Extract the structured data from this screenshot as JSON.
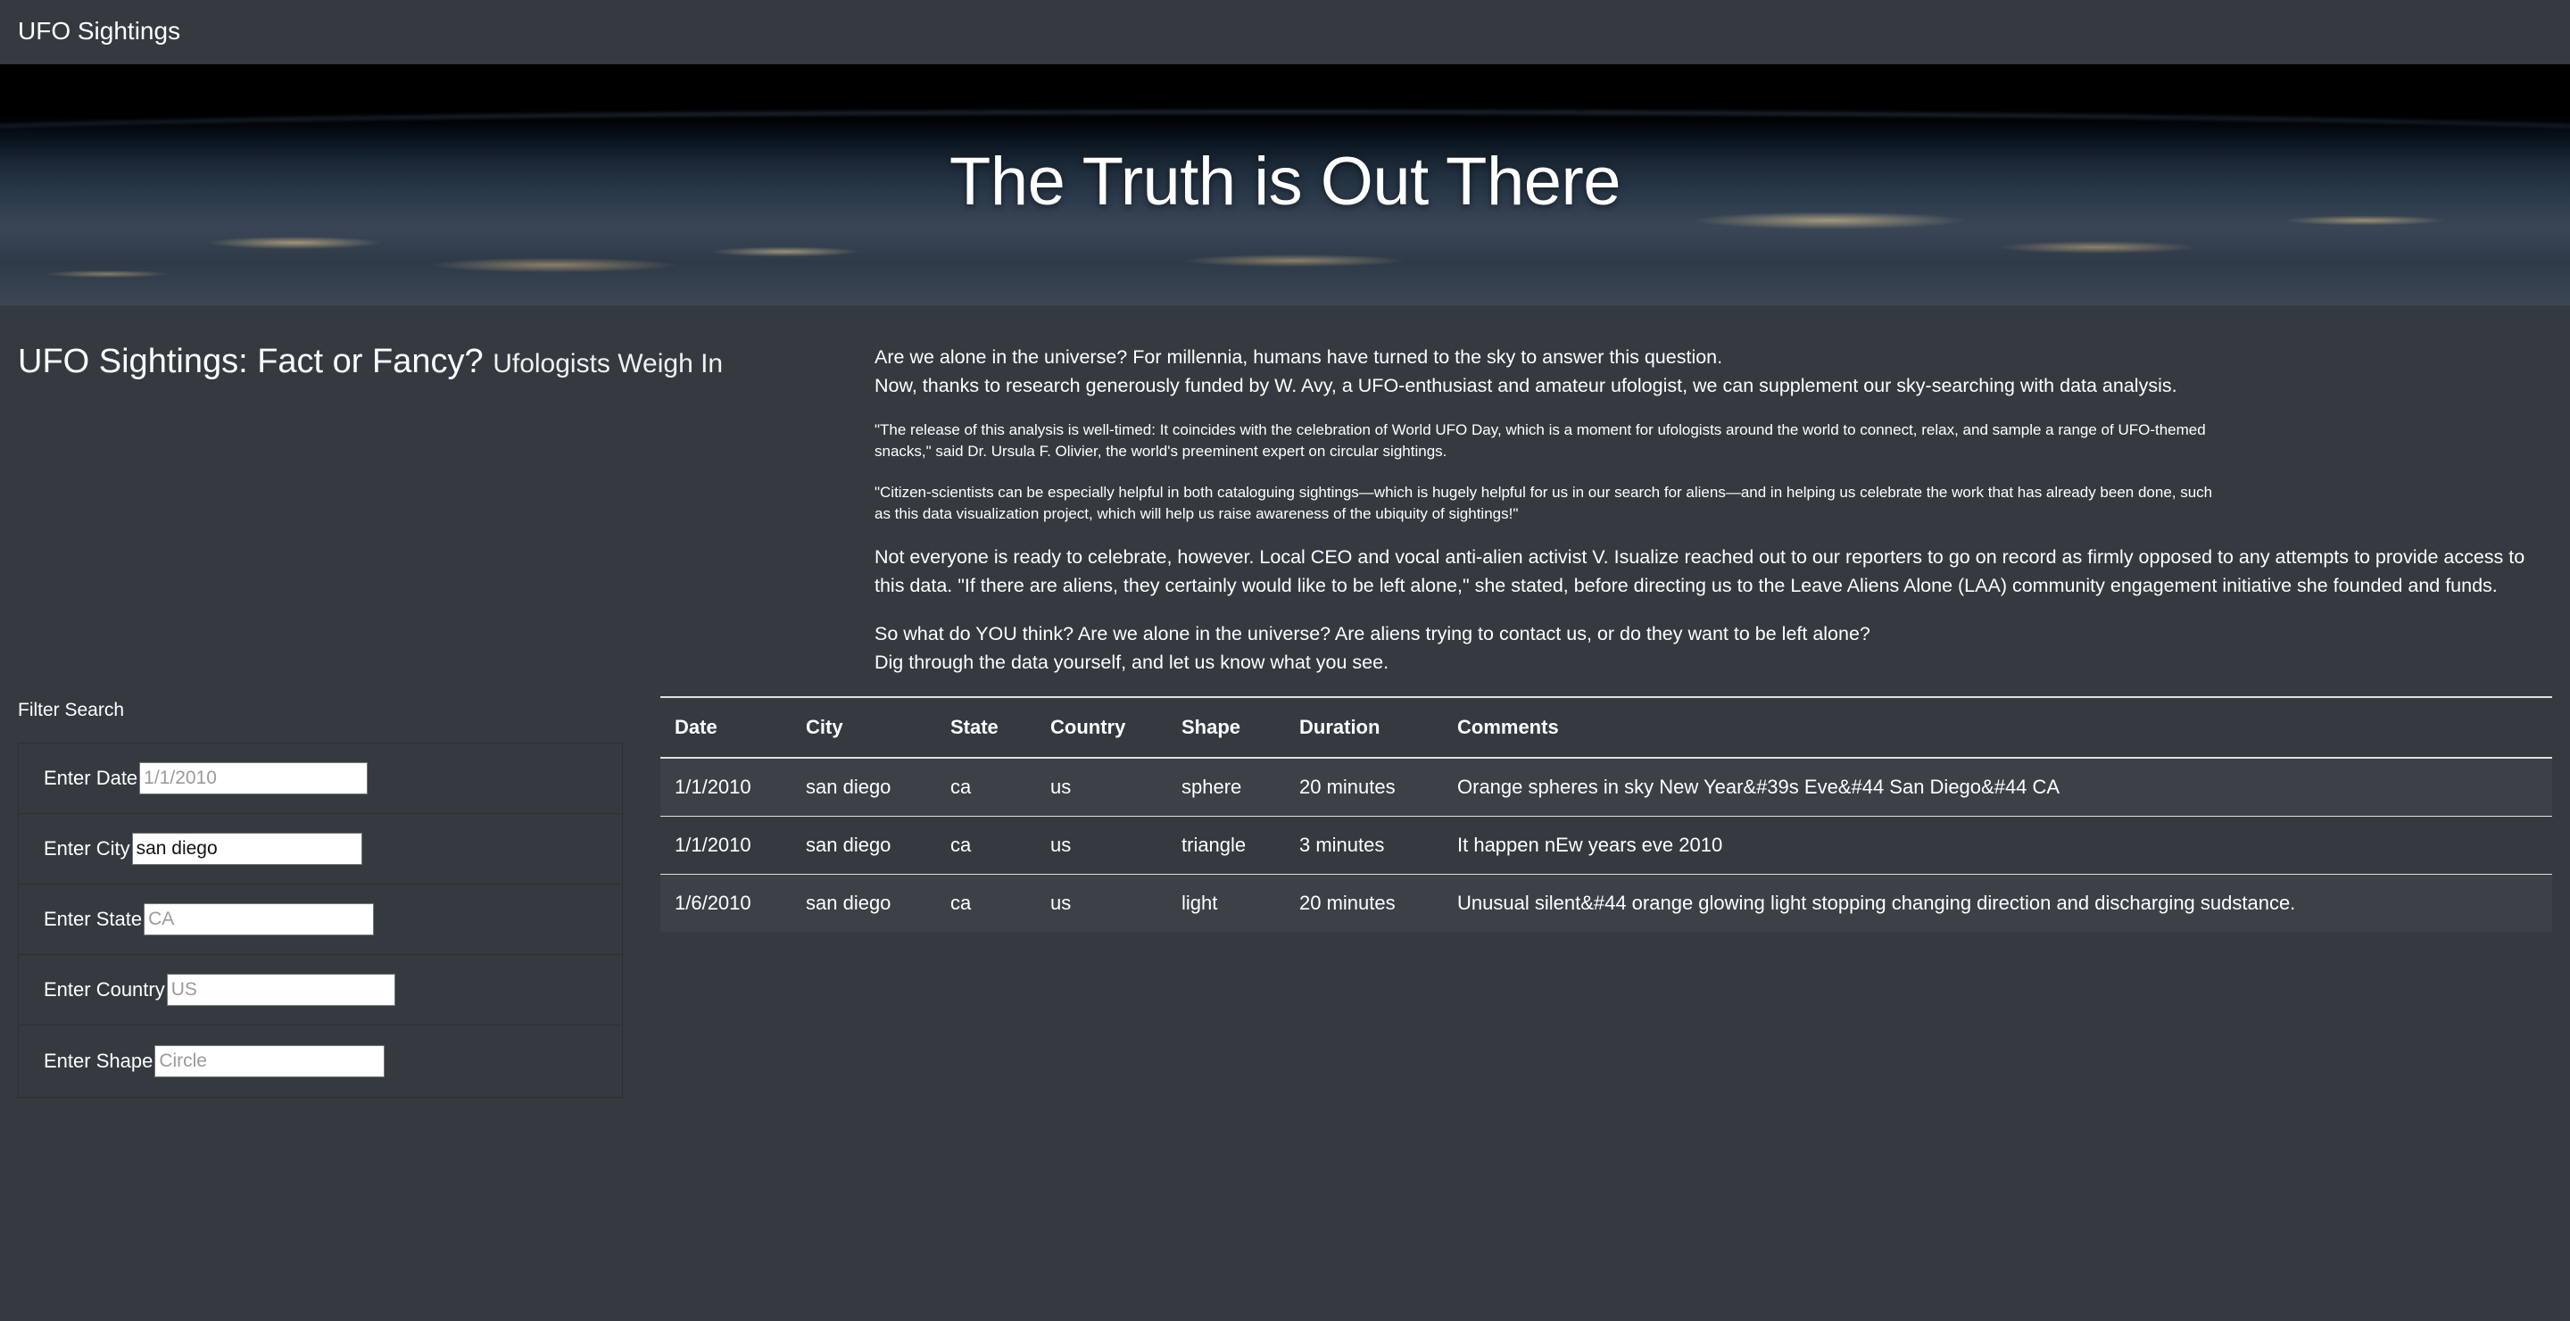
{
  "navbar": {
    "brand": "UFO Sightings"
  },
  "hero": {
    "title": "The Truth is Out There"
  },
  "headline": {
    "title": "UFO Sightings: Fact or Fancy?",
    "subtitle": "Ufologists Weigh In"
  },
  "article": {
    "p1_line1": "Are we alone in the universe? For millennia, humans have turned to the sky to answer this question.",
    "p1_line2": "Now, thanks to research generously funded by W. Avy, a UFO-enthusiast and amateur ufologist, we can supplement our sky-searching with data analysis.",
    "quote1": "\"The release of this analysis is well-timed: It coincides with the celebration of World UFO Day, which is a moment for ufologists around the world to connect, relax, and sample a range of UFO-themed snacks,\" said Dr. Ursula F. Olivier, the world's preeminent expert on circular sightings.",
    "quote2": "\"Citizen-scientists can be especially helpful in both cataloguing sightings—which is hugely helpful for us in our search for aliens—and in helping us celebrate the work that has already been done, such as this data visualization project, which will help us raise awareness of the ubiquity of sightings!\"",
    "p2": "Not everyone is ready to celebrate, however. Local CEO and vocal anti-alien activist V. Isualize reached out to our reporters to go on record as firmly opposed to any attempts to provide access to this data. \"If there are aliens, they certainly would like to be left alone,\" she stated, before directing us to the Leave Aliens Alone (LAA) community engagement initiative she founded and funds.",
    "p3_line1": "So what do YOU think? Are we alone in the universe? Are aliens trying to contact us, or do they want to be left alone?",
    "p3_line2": "Dig through the data yourself, and let us know what you see."
  },
  "filters": {
    "title": "Filter Search",
    "date": {
      "label": "Enter Date",
      "placeholder": "1/1/2010",
      "value": ""
    },
    "city": {
      "label": "Enter City",
      "placeholder": "",
      "value": "san diego"
    },
    "state": {
      "label": "Enter State",
      "placeholder": "CA",
      "value": ""
    },
    "country": {
      "label": "Enter Country",
      "placeholder": "US",
      "value": ""
    },
    "shape": {
      "label": "Enter Shape",
      "placeholder": "Circle",
      "value": ""
    }
  },
  "table": {
    "headers": [
      "Date",
      "City",
      "State",
      "Country",
      "Shape",
      "Duration",
      "Comments"
    ],
    "rows": [
      [
        "1/1/2010",
        "san diego",
        "ca",
        "us",
        "sphere",
        "20 minutes",
        "Orange spheres in sky New Year&#39s Eve&#44 San Diego&#44 CA"
      ],
      [
        "1/1/2010",
        "san diego",
        "ca",
        "us",
        "triangle",
        "3 minutes",
        "It happen nEw years eve 2010"
      ],
      [
        "1/6/2010",
        "san diego",
        "ca",
        "us",
        "light",
        "20 minutes",
        "Unusual silent&#44 orange glowing light stopping changing direction and discharging sudstance."
      ]
    ]
  }
}
